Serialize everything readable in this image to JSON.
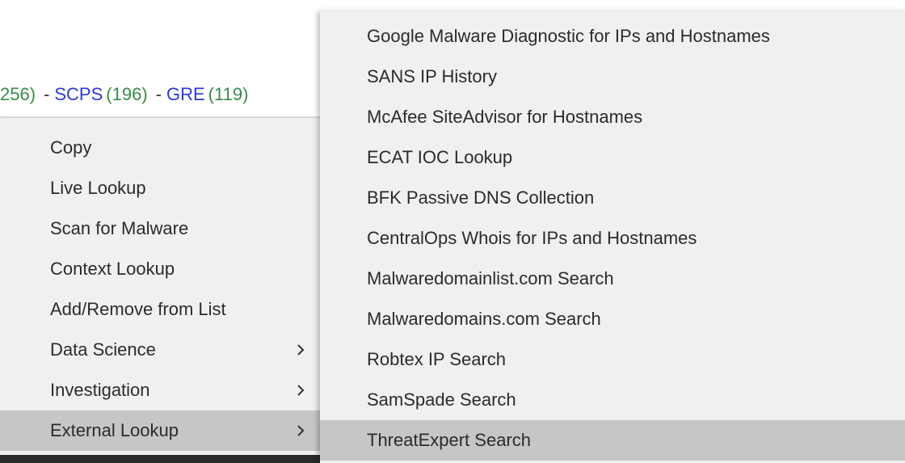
{
  "filter_bar": {
    "first_count": "256)",
    "items": [
      {
        "name": "SCPS",
        "count": "(196)"
      },
      {
        "name": "GRE",
        "count": "(119)"
      }
    ],
    "separator": "-"
  },
  "context_menu": {
    "items": [
      {
        "label": "Copy",
        "submenu": false
      },
      {
        "label": "Live Lookup",
        "submenu": false
      },
      {
        "label": "Scan for Malware",
        "submenu": false
      },
      {
        "label": "Context Lookup",
        "submenu": false
      },
      {
        "label": "Add/Remove from List",
        "submenu": false
      },
      {
        "label": "Data Science",
        "submenu": true
      },
      {
        "label": "Investigation",
        "submenu": true
      },
      {
        "label": "External Lookup",
        "submenu": true,
        "active": true
      }
    ]
  },
  "external_lookup_submenu": {
    "items": [
      {
        "label": "Google Malware Diagnostic for IPs and Hostnames"
      },
      {
        "label": "SANS IP History"
      },
      {
        "label": "McAfee SiteAdvisor for Hostnames"
      },
      {
        "label": "ECAT IOC Lookup"
      },
      {
        "label": "BFK Passive DNS Collection"
      },
      {
        "label": "CentralOps Whois for IPs and Hostnames"
      },
      {
        "label": "Malwaredomainlist.com Search"
      },
      {
        "label": "Malwaredomains.com Search"
      },
      {
        "label": "Robtex IP Search"
      },
      {
        "label": "SamSpade Search"
      },
      {
        "label": "ThreatExpert Search",
        "active": true
      }
    ]
  },
  "colors": {
    "menu_background": "#f0f0f0",
    "highlight": "#c6c6c6",
    "link_blue": "#2e3ad6",
    "count_green": "#3a8b4c",
    "text": "#2b2b2b"
  },
  "icons": {
    "submenu_indicator": "chevron-right-icon"
  }
}
